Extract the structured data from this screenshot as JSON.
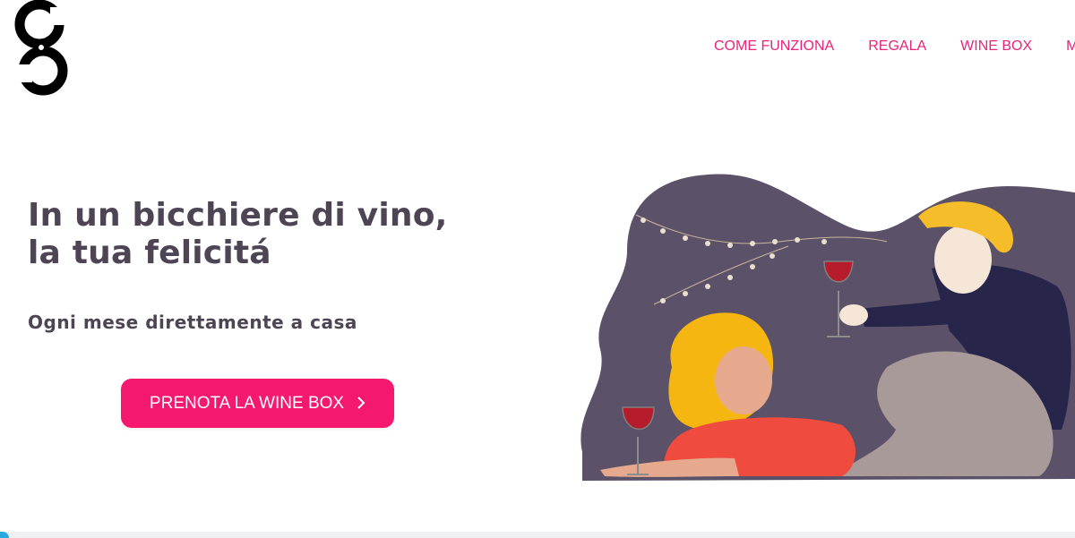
{
  "header": {
    "logo_icon": "brand-logo-icon",
    "nav": [
      {
        "label": "COME FUNZIONA"
      },
      {
        "label": "REGALA"
      },
      {
        "label": "WINE BOX"
      },
      {
        "label": "MA"
      }
    ]
  },
  "hero": {
    "title_line1": "In un bicchiere di vino,",
    "title_line2": "la tua felicitá",
    "subtitle": "Ogni mese direttamente a casa",
    "cta_label": "PRENOTA LA WINE BOX",
    "cta_icon": "chevron-right-icon",
    "illustration": "couple-with-wine-illustration"
  },
  "colors": {
    "accent": "#f5186f",
    "nav_text": "#e8247c",
    "heading_text": "#4e4554",
    "illustration_bg": "#5b5169"
  }
}
